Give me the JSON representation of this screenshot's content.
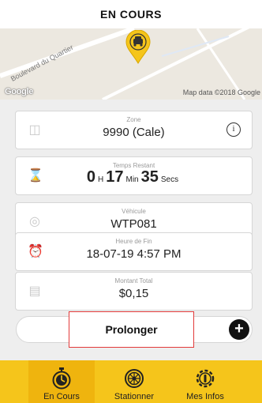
{
  "header": {
    "title": "EN COURS"
  },
  "map": {
    "street_label": "Boulevard du Quartier",
    "logo_text": "Google",
    "attribution": "Map data ©2018 Google",
    "pin_icon": "car-pin-icon"
  },
  "cards": {
    "zone": {
      "label": "Zone",
      "value": "9990 (Cale)",
      "icon": "parking-grid-icon"
    },
    "remaining": {
      "label": "Temps Restant",
      "hours": "0",
      "hours_unit": "H",
      "minutes": "17",
      "minutes_unit": "Min",
      "seconds": "35",
      "seconds_unit": "Secs",
      "icon": "hourglass-icon"
    },
    "vehicle": {
      "label": "Véhicule",
      "value": "WTP081",
      "icon": "steering-wheel-icon"
    },
    "end_time": {
      "label": "Heure de Fin",
      "value": "18-07-19 4:57 PM",
      "icon": "alarm-clock-icon"
    },
    "total": {
      "label": "Montant Total",
      "value": "$0,15",
      "icon": "coins-icon"
    }
  },
  "actions": {
    "extend_label": "Prolonger",
    "add_symbol": "+"
  },
  "tabs": [
    {
      "label": "En Cours",
      "icon": "stopwatch-icon",
      "active": true
    },
    {
      "label": "Stationner",
      "icon": "wheel-icon",
      "active": false
    },
    {
      "label": "Mes Infos",
      "icon": "gear-icon",
      "active": false
    }
  ],
  "colors": {
    "accent": "#f5c51b",
    "active_tab": "#efb40e",
    "highlight": "#e23a3a"
  }
}
